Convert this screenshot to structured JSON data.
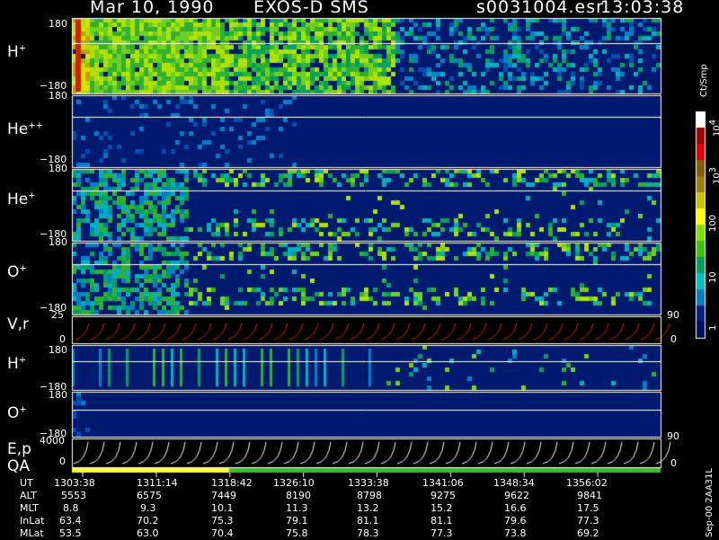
{
  "header": {
    "date": "Mar 10, 1990",
    "mission": "EXOS-D SMS",
    "file": "s0031004.esr",
    "time": "13:03:38"
  },
  "panels": [
    {
      "label": "H",
      "sup": "+",
      "top": "180",
      "bottom": "−180"
    },
    {
      "label": "He",
      "sup": "++",
      "top": "180",
      "bottom": "−180"
    },
    {
      "label": "He",
      "sup": "+",
      "top": "180",
      "bottom": "−180"
    },
    {
      "label": "O",
      "sup": "+",
      "top": "180",
      "bottom": "−180"
    },
    {
      "label": "V,r",
      "top": "25",
      "bottom": "0",
      "right_top": "90",
      "right_bottom": "0"
    },
    {
      "label": "H",
      "sup": "+",
      "top": "180",
      "bottom": "−180"
    },
    {
      "label": "O",
      "sup": "+",
      "top": "180",
      "bottom": "−180"
    },
    {
      "label": "E,p",
      "top": "4000",
      "bottom": "0",
      "right_top": "90",
      "right_bottom": "0"
    },
    {
      "label": "QA"
    }
  ],
  "colorbar": {
    "unit": "Ct/Smp",
    "ticks": [
      "10^4",
      "10^3",
      "100",
      "10",
      "1"
    ],
    "colors": [
      "#ffffff",
      "#a00000",
      "#e00000",
      "#806000",
      "#a08000",
      "#c8c000",
      "#ffff00",
      "#80e000",
      "#40c000",
      "#00a060",
      "#00c0c0",
      "#0080c0",
      "#002080",
      "#001060"
    ]
  },
  "table": {
    "rows": [
      {
        "name": "UT",
        "values": [
          "1303:38",
          "1311:14",
          "1318:42",
          "1326:10",
          "1333:38",
          "1341:06",
          "1348:34",
          "1356:02"
        ]
      },
      {
        "name": "ALT",
        "values": [
          "5553",
          "6575",
          "7449",
          "8190",
          "8798",
          "9275",
          "9622",
          "9841"
        ]
      },
      {
        "name": "MLT",
        "values": [
          "8.8",
          "9.3",
          "10.1",
          "11.3",
          "13.2",
          "15.2",
          "16.6",
          "17.5"
        ]
      },
      {
        "name": "InLat",
        "values": [
          "63.4",
          "70.2",
          "75.3",
          "79.1",
          "81.1",
          "81.1",
          "79.6",
          "77.3"
        ]
      },
      {
        "name": "MLat",
        "values": [
          "53.5",
          "63.0",
          "70.4",
          "75.8",
          "78.3",
          "77.3",
          "73.8",
          "69.2"
        ]
      }
    ]
  },
  "footer": "Sep-00  2AA31L",
  "chart_data": {
    "type": "heatmap",
    "title": "Mar 10, 1990   EXOS-D SMS",
    "x_ticks": [
      "1303:38",
      "1311:14",
      "1318:42",
      "1326:10",
      "1333:38",
      "1341:06",
      "1348:34",
      "1356:02"
    ],
    "ylim": [
      -180,
      180
    ],
    "colorbar_range": [
      1,
      10000
    ],
    "series": [
      {
        "name": "H+"
      },
      {
        "name": "He++"
      },
      {
        "name": "He+"
      },
      {
        "name": "O+"
      },
      {
        "name": "V,r"
      },
      {
        "name": "H+"
      },
      {
        "name": "O+"
      },
      {
        "name": "E,p"
      },
      {
        "name": "QA"
      }
    ]
  }
}
